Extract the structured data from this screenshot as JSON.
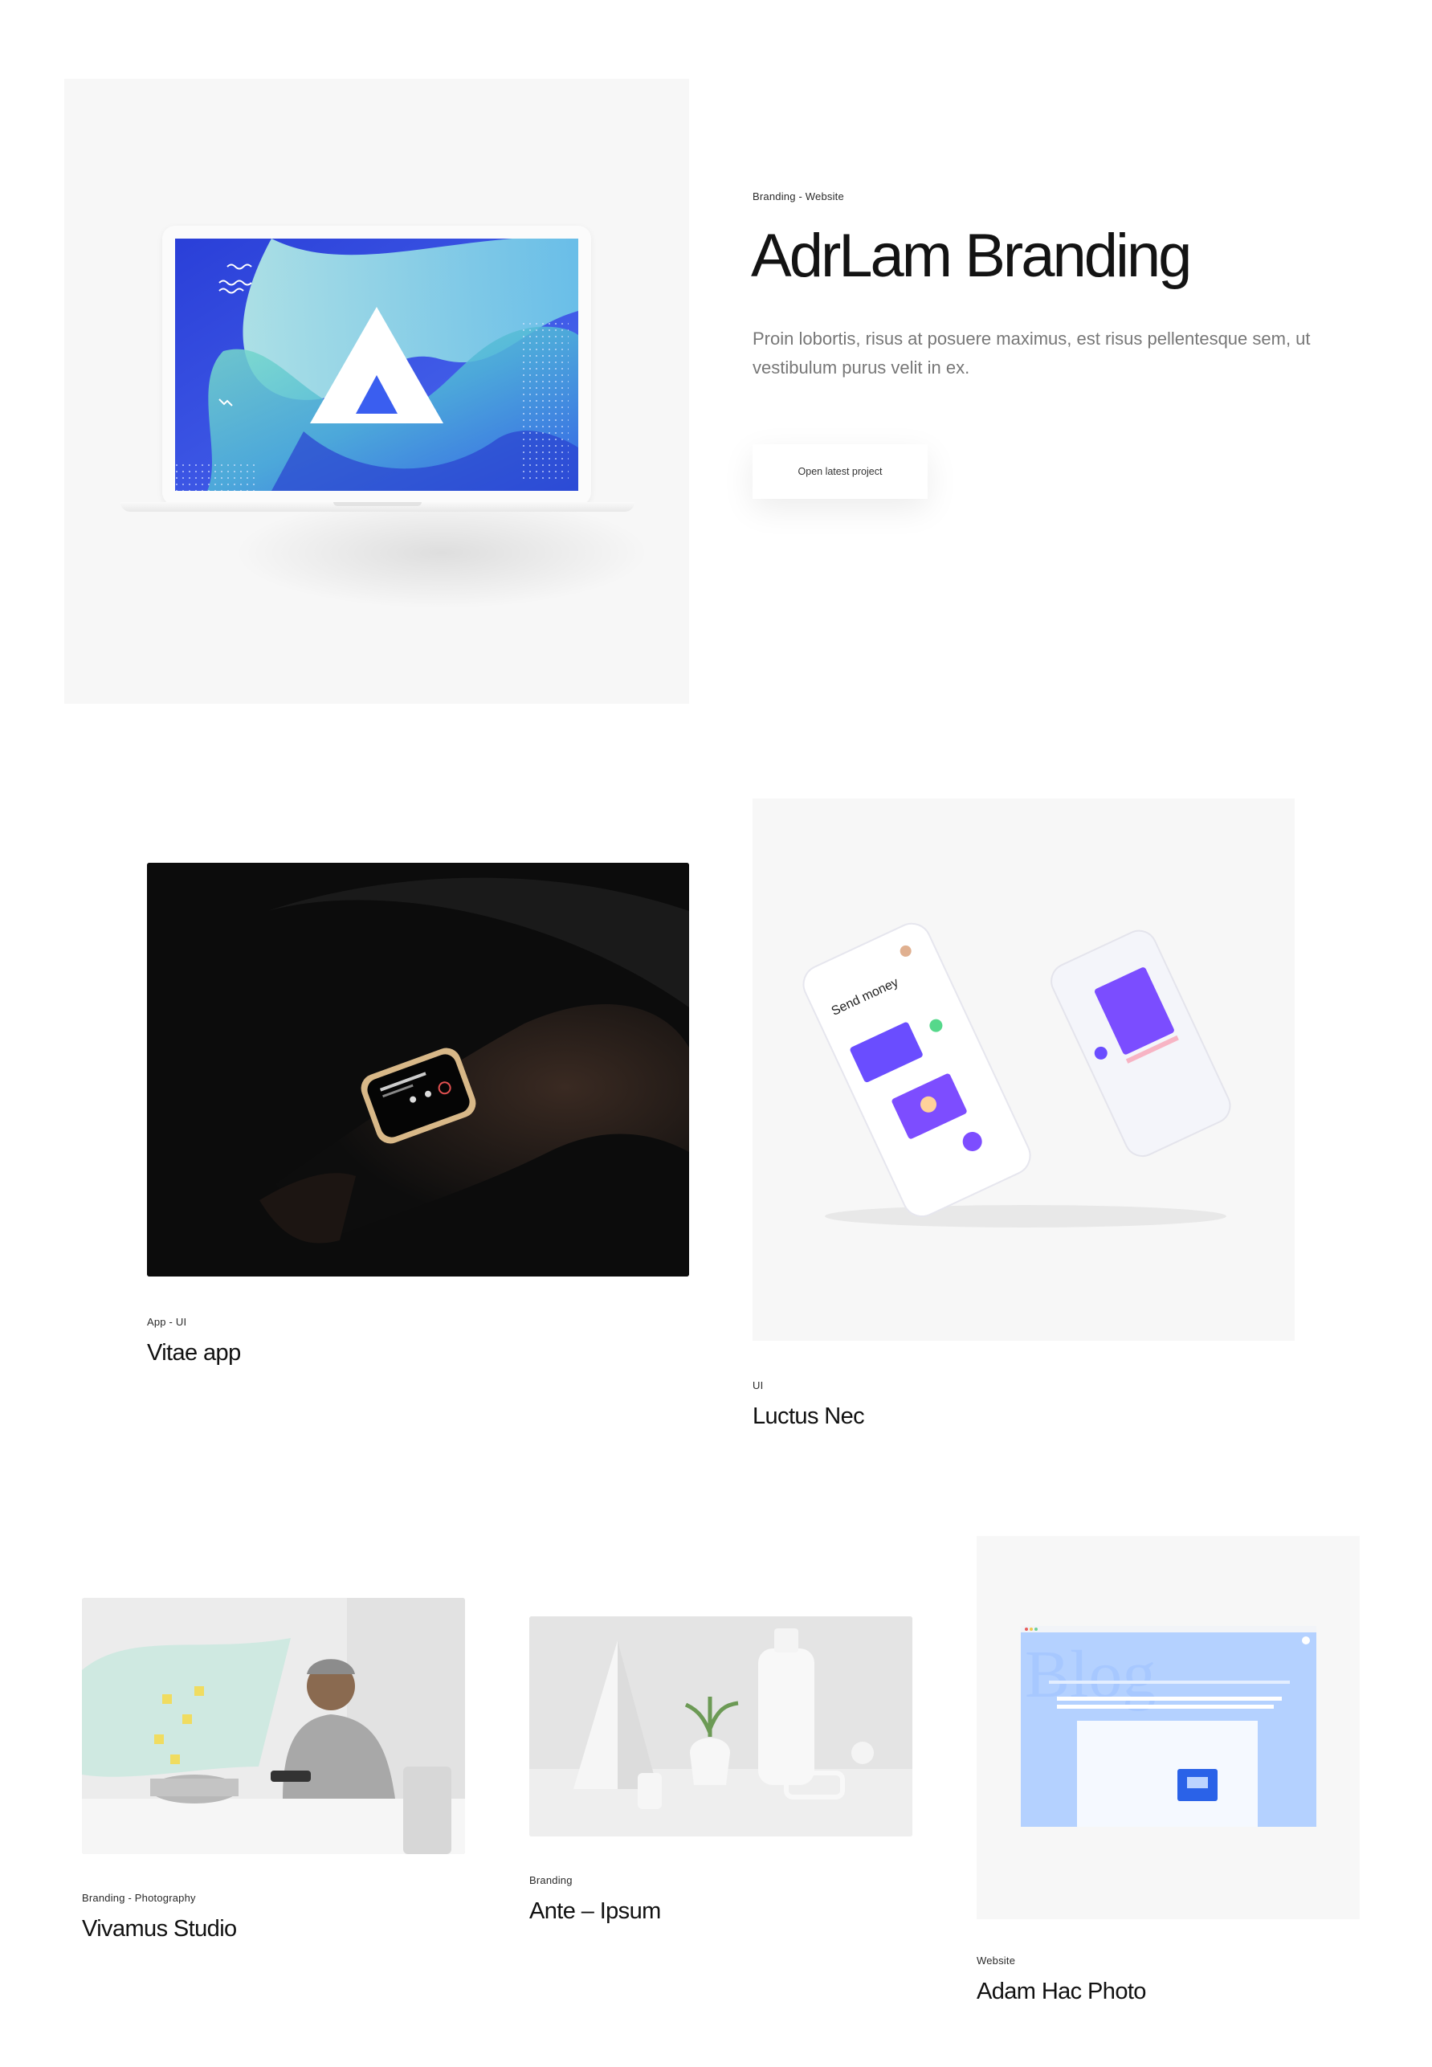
{
  "hero": {
    "category": "Branding - Website",
    "title": "AdrLam Branding",
    "description": "Proin lobortis, risus at posuere maximus, est risus pellentesque sem, ut vestibulum purus velit in ex.",
    "button_label": "Open latest project"
  },
  "projects": [
    {
      "category": "App - UI",
      "title": "Vitae app"
    },
    {
      "category": "UI",
      "title": "Luctus Nec"
    },
    {
      "category": "Branding - Photography",
      "title": "Vivamus Studio"
    },
    {
      "category": "Branding",
      "title": "Ante – Ipsum"
    },
    {
      "category": "Website",
      "title": "Adam Hac Photo"
    }
  ],
  "images": {
    "phone_screen_heading": "Send money",
    "blog_bg_word": "Blog"
  },
  "colors": {
    "card_bg": "#f7f7f7",
    "text": "#151515",
    "muted_text": "#777777",
    "accent_purple": "#7d4dff",
    "accent_blue": "#3b5cff"
  }
}
